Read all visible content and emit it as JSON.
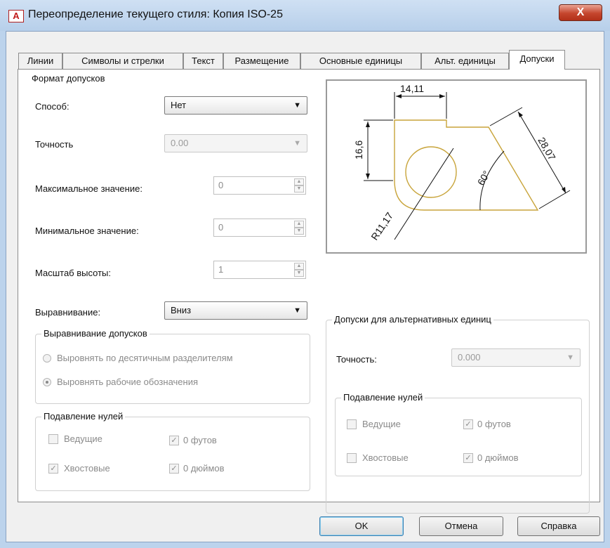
{
  "window": {
    "title": "Переопределение текущего стиля: Копия ISO-25",
    "app_icon_text": "A",
    "close_glyph": "X"
  },
  "tabs": [
    {
      "label": "Линии"
    },
    {
      "label": "Символы и стрелки"
    },
    {
      "label": "Текст"
    },
    {
      "label": "Размещение"
    },
    {
      "label": "Основные единицы"
    },
    {
      "label": "Альт. единицы"
    },
    {
      "label": "Допуски",
      "active": true
    }
  ],
  "tolerance_format": {
    "title": "Формат допусков",
    "method_label": "Способ:",
    "method_value": "Нет",
    "precision_label": "Точность",
    "precision_value": "0.00",
    "max_label": "Максимальное значение:",
    "max_value": "0",
    "min_label": "Минимальное значение:",
    "min_value": "0",
    "height_scale_label": "Масштаб высоты:",
    "height_scale_value": "1",
    "vertical_pos_label": "Выравнивание:",
    "vertical_pos_value": "Вниз"
  },
  "tolerance_alignment": {
    "title": "Выравнивание допусков",
    "option_decimal": "Выровнять по десятичным разделителям",
    "option_symbols": "Выровнять рабочие обозначения",
    "selected": "symbols"
  },
  "zero_suppression": {
    "title": "Подавление нулей",
    "leading": "Ведущие",
    "trailing": "Хвостовые",
    "feet": "0 футов",
    "inches": "0 дюймов",
    "leading_checked": false,
    "trailing_checked": true,
    "feet_checked": true,
    "inches_checked": true
  },
  "preview": {
    "dim_top": "14,11",
    "dim_left": "16,6",
    "dim_right": "28,07",
    "dim_angle": "60°",
    "dim_radius": "R11,17",
    "line_color": "#c8a43a"
  },
  "alt_tolerance": {
    "title": "Допуски для альтернативных единиц",
    "precision_label": "Точность:",
    "precision_value": "0.000"
  },
  "alt_zero_suppression": {
    "title": "Подавление нулей",
    "leading": "Ведущие",
    "trailing": "Хвостовые",
    "feet": "0 футов",
    "inches": "0 дюймов",
    "leading_checked": false,
    "trailing_checked": false,
    "feet_checked": true,
    "inches_checked": true
  },
  "buttons": {
    "ok": "OK",
    "cancel": "Отмена",
    "help": "Справка"
  }
}
